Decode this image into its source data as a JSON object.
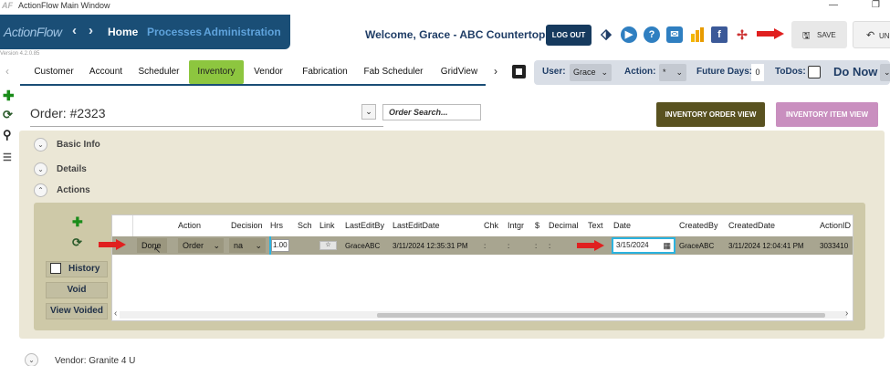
{
  "window": {
    "app_icon": "AF",
    "title": "ActionFlow Main Window",
    "minimize": "—",
    "maximize": "❐"
  },
  "header": {
    "logo": "ActionFlow",
    "back": "‹",
    "forward": "›",
    "nav": [
      "Home",
      "Processes",
      "Administration"
    ],
    "version": "Version 4.2.0.85",
    "welcome": "Welcome, Grace - ABC Countertops",
    "logout": "LOG OUT",
    "save": "SAVE",
    "undo": "UN",
    "icons": [
      "tag-icon",
      "play-icon",
      "help-icon",
      "mail-icon",
      "chart-icon",
      "facebook-icon",
      "pinwheel-icon"
    ]
  },
  "tabs": {
    "prev": "‹",
    "items": [
      "Customer",
      "Account",
      "Scheduler",
      "Inventory",
      "Vendor",
      "Fabrication",
      "Fab Scheduler",
      "GridView"
    ],
    "active": "Inventory",
    "next": "›"
  },
  "filter": {
    "user_label": "User:",
    "user_value": "Grace",
    "action_label": "Action:",
    "action_value": "*",
    "future_label": "Future Days:",
    "future_value": "0",
    "todos_label": "ToDos:",
    "do_now": "Do Now"
  },
  "order": {
    "title": "Order:  #2323",
    "search_placeholder": "Order Search...",
    "btn_inventory_order": "INVENTORY ORDER VIEW",
    "btn_inventory_item": "INVENTORY ITEM VIEW"
  },
  "sections": {
    "basic_info": "Basic Info",
    "details": "Details",
    "actions": "Actions"
  },
  "side_buttons": {
    "history": "History",
    "void": "Void",
    "view_voided": "View Voided"
  },
  "grid": {
    "columns": [
      "Action",
      "Decision",
      "Hrs",
      "Sch",
      "Link",
      "LastEditBy",
      "LastEditDate",
      "Chk",
      "Intgr",
      "$",
      "Decimal",
      "Text",
      "Date",
      "CreatedBy",
      "CreatedDate",
      "ActionID"
    ],
    "row": {
      "done": "Done",
      "action": "Order",
      "decision": "na",
      "hrs": "1.00",
      "link": "☆",
      "last_edit_by": "GraceABC",
      "last_edit_date": "3/11/2024 12:35:31 PM",
      "chk": ":",
      "intgr": ":",
      "dollar": ":",
      "decimal": ":",
      "date": "3/15/2024",
      "created_by": "GraceABC",
      "created_date": "3/11/2024 12:04:41 PM",
      "action_id": "3033410"
    },
    "scroll_left": "‹",
    "scroll_right": "›"
  },
  "vendor": "Vendor: Granite 4 U",
  "colors": {
    "brand": "#1a4e76",
    "active_tab": "#8dc63f",
    "arrow": "#e02020"
  }
}
